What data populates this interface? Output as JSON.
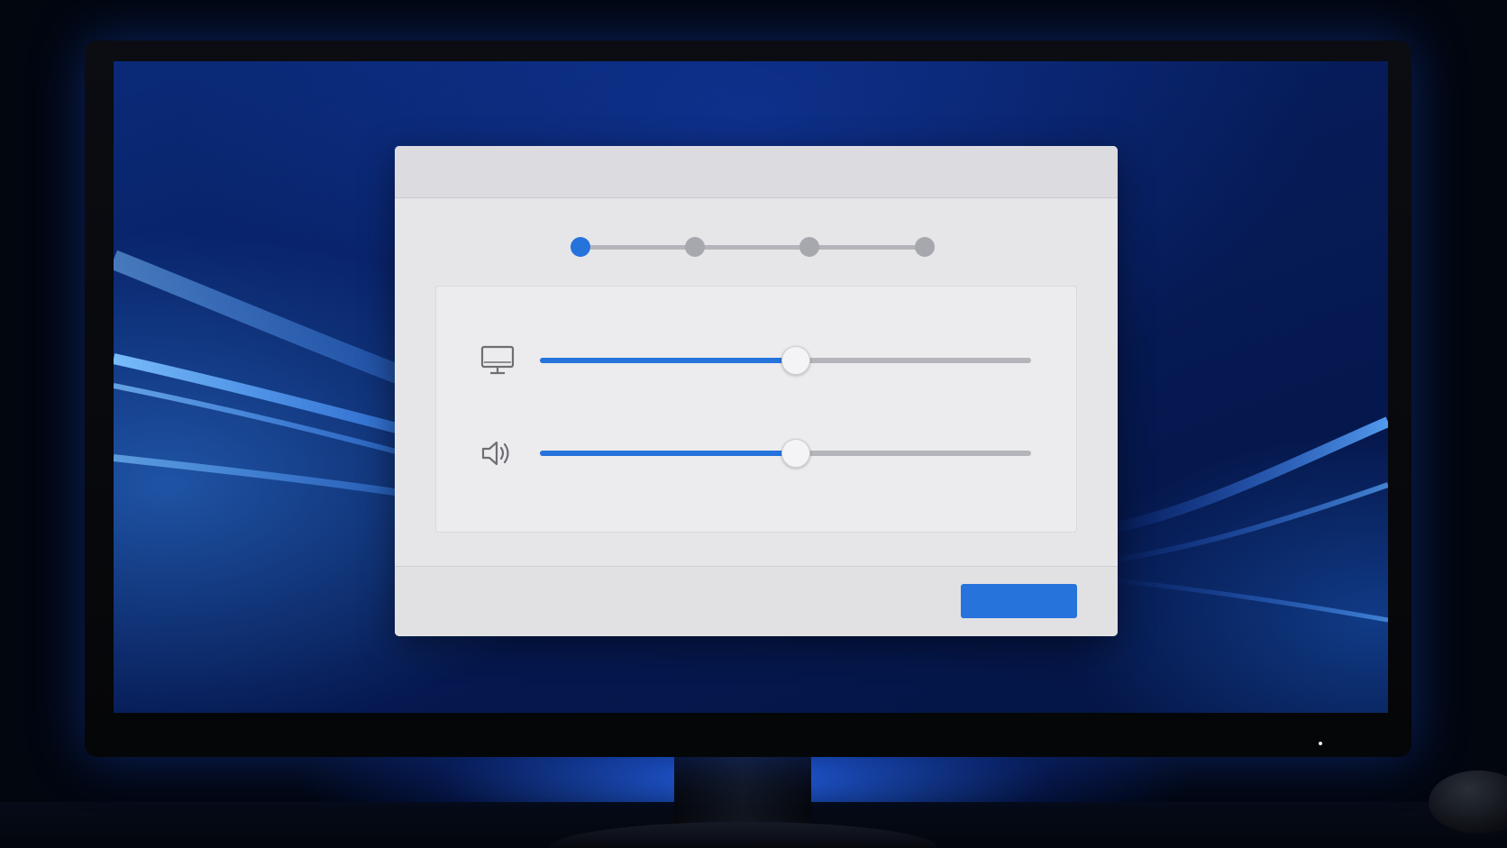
{
  "dialog": {
    "title": "",
    "stepper": {
      "total_steps": 4,
      "current_step": 1,
      "steps": [
        {
          "state": "active"
        },
        {
          "state": "inactive"
        },
        {
          "state": "inactive"
        },
        {
          "state": "inactive"
        }
      ]
    },
    "settings": [
      {
        "id": "display",
        "icon": "monitor-icon",
        "level_fraction": 0.52
      },
      {
        "id": "volume",
        "icon": "speaker-icon",
        "level_fraction": 0.52
      }
    ],
    "footer": {
      "primary_button_label": ""
    }
  },
  "colors": {
    "accent": "#2673dc",
    "track": "#b4b5ba",
    "dialog_bg": "#e6e6e9",
    "desktop_bg": "#061b57"
  }
}
